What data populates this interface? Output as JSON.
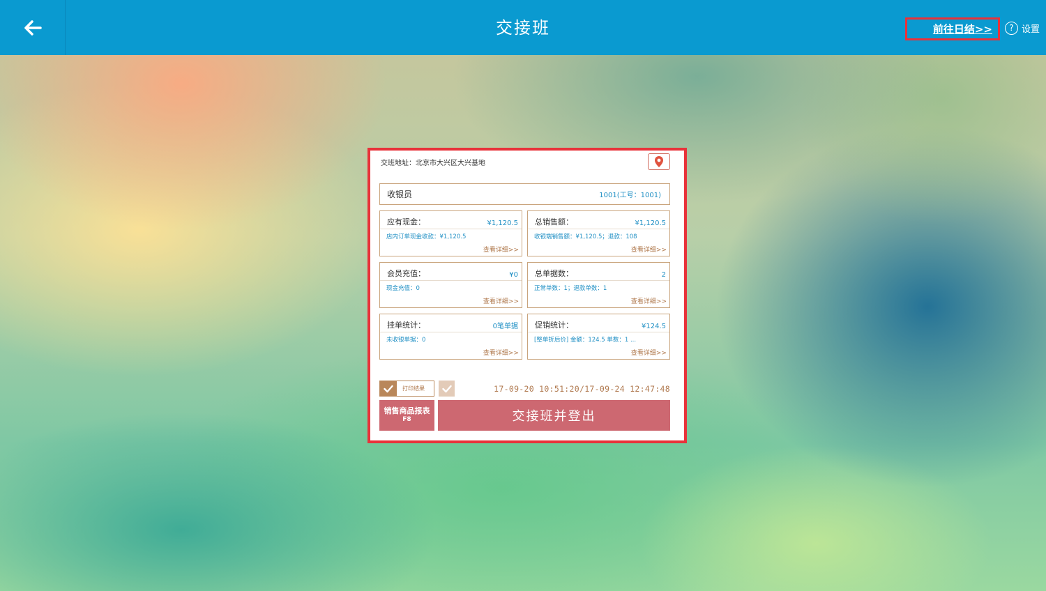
{
  "header": {
    "title": "交接班",
    "goto_daily": "前往日结>>",
    "settings_label": "设置",
    "help_glyph": "?"
  },
  "panel": {
    "address": "交班地址：北京市大兴区大兴基地",
    "cashier": {
      "label": "收银员",
      "value": "1001(工号：1001)"
    },
    "cards": [
      {
        "label": "应有现金：",
        "value": "¥1,120.5",
        "sub": "店内订单现金收款：¥1,120.5",
        "detail": "查看详细>>"
      },
      {
        "label": "总销售额：",
        "value": "¥1,120.5",
        "sub": "收银端销售额：¥1,120.5；退款：108",
        "detail": "查看详细>>"
      },
      {
        "label": "会员充值：",
        "value": "¥0",
        "sub": "现金充值：0",
        "detail": "查看详细>>"
      },
      {
        "label": "总单据数：",
        "value": "2",
        "sub": "正常单数：1；退款单数：1",
        "detail": "查看详细>>"
      },
      {
        "label": "挂单统计：",
        "value": "0笔单据",
        "sub": "未收银单据：0",
        "detail": "查看详细>>"
      },
      {
        "label": "促销统计：",
        "value": "¥124.5",
        "sub": "[整单折后价] 金额：124.5 单数：1 ...",
        "detail": "查看详细>>"
      }
    ],
    "print_result_label": "打印结果",
    "time_range": "17-09-20 10:51:20/17-09-24 12:47:48",
    "report_button": {
      "label": "销售商品报表",
      "key": "F8"
    },
    "logout_button": "交接班并登出"
  },
  "colors": {
    "topbar": "#0a9ad0",
    "highlight": "#e8323a",
    "value_blue": "#1f8fc4",
    "accent_brown": "#b9875a",
    "button_red": "#cd6871"
  },
  "icons": [
    "back-arrow-icon",
    "help-circle-icon",
    "map-pin-icon",
    "checkmark-icon"
  ]
}
